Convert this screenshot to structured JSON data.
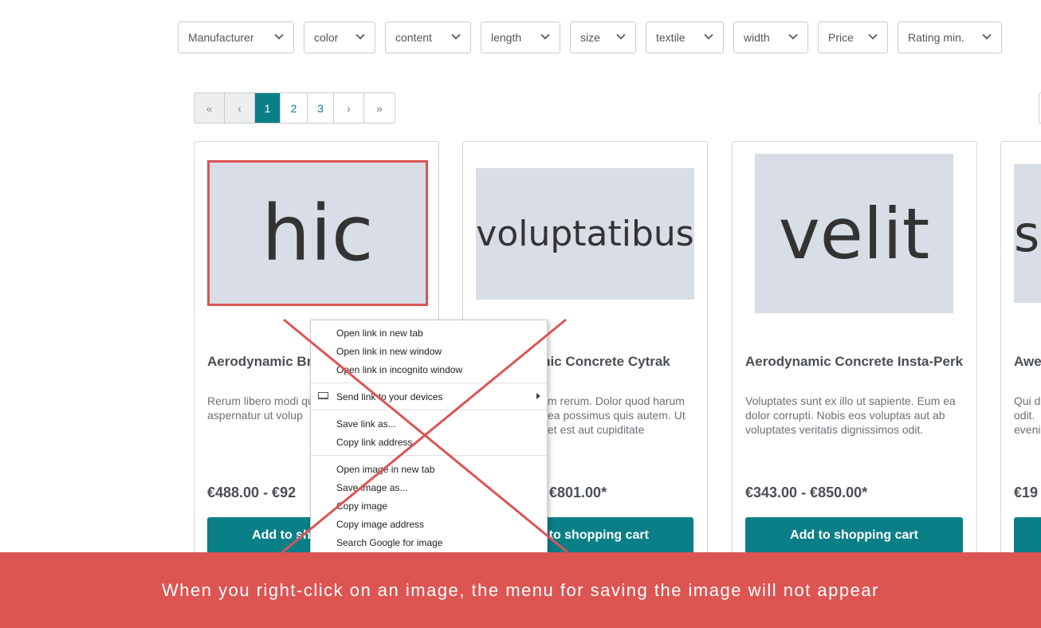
{
  "filters": [
    "Manufacturer",
    "color",
    "content",
    "length",
    "size",
    "textile",
    "width",
    "Price",
    "Rating min."
  ],
  "pagination": {
    "first": "«",
    "prev": "‹",
    "pages": [
      "1",
      "2",
      "3"
    ],
    "current": "1",
    "next": "›",
    "last": "»"
  },
  "products": [
    {
      "image_text": "hic",
      "title": "Aerodynamic Bronze CoffeeMatic",
      "description": "Rerum libero modi quam. Possimus vol aspernatur ut volup",
      "price": "€488.00 - €92",
      "button": "Add to shopping cart"
    },
    {
      "image_text": "voluptatibus",
      "title": "Aerodynamic Concrete Cytrak",
      "description": "m rerum. Dolor quod harum ea possimus quis autem. Ut et est aut cupiditate",
      "price": "€801.00*",
      "button": "Add to shopping cart"
    },
    {
      "image_text": "velit",
      "title": "Aerodynamic Concrete Insta-Perk",
      "description": "Voluptates sunt ex illo ut sapiente. Eum ea dolor corrupti. Nobis eos voluptas aut ab voluptates veritatis dignissimos odit.",
      "price": "€343.00 - €850.00*",
      "button": "Add to shopping cart"
    },
    {
      "image_text": "s",
      "title": "Awe",
      "description": "Qui d odit. eveni",
      "price": "€19",
      "button": ""
    }
  ],
  "context_menu": {
    "items": [
      "Open link in new tab",
      "Open link in new window",
      "Open link in incognito window",
      "Send link to your devices",
      "Save link as...",
      "Copy link address",
      "Open image in new tab",
      "Save image as...",
      "Copy image",
      "Copy image address",
      "Search Google for image"
    ]
  },
  "banner": {
    "text": "When you right-click on an image, the menu for saving the image will not appear",
    "color": "#dc5553"
  },
  "colors": {
    "accent": "#0a7f87",
    "highlight": "#dc5553"
  }
}
